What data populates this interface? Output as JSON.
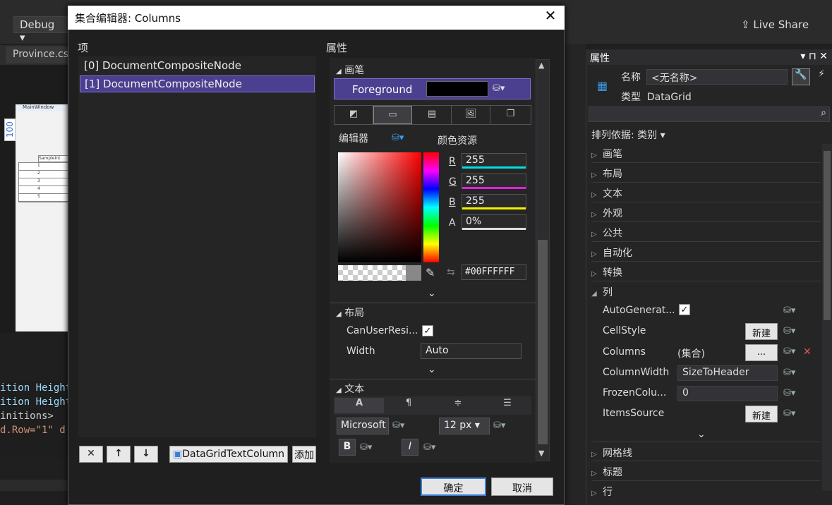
{
  "toolbar": {
    "config": "Debug",
    "live_share": "Live Share"
  },
  "editor_tab": "Province.cs",
  "designer": {
    "window_title": "MainWindow",
    "grid_header": "SampleInt",
    "rows": [
      "1",
      "2",
      "3",
      "4",
      "5"
    ],
    "ruler_value": "100"
  },
  "code_lines": [
    "ition Height=",
    "ition Height=",
    "initions>",
    "d.Row=\"1\" d:I"
  ],
  "properties_panel": {
    "title": "属性",
    "name_label": "名称",
    "name_value": "<无名称>",
    "type_label": "类型",
    "type_value": "DataGrid",
    "sort_label": "排列依据: 类别",
    "categories_top": [
      "画笔",
      "布局",
      "文本",
      "外观",
      "公共",
      "自动化",
      "转换"
    ],
    "expanded_category": "列",
    "rows": [
      {
        "name": "AutoGenerat...",
        "value": ""
      },
      {
        "name": "CellStyle",
        "value": "新建"
      },
      {
        "name": "Columns",
        "value": "(集合)",
        "button": "..."
      },
      {
        "name": "ColumnWidth",
        "value": "SizeToHeader"
      },
      {
        "name": "FrozenColu...",
        "value": "0"
      },
      {
        "name": "ItemsSource",
        "value": "新建"
      }
    ],
    "categories_bottom": [
      "网格线",
      "标题",
      "行"
    ]
  },
  "dialog": {
    "title": "集合编辑器: Columns",
    "items_label": "项",
    "props_label": "属性",
    "items": [
      "[0] DocumentCompositeNode",
      "[1] DocumentCompositeNode"
    ],
    "selected_item": 1,
    "add_combo": "DataGridTextColumn",
    "add_button": "添加",
    "brush_section": "画笔",
    "foreground_label": "Foreground",
    "foreground_color": "#000000",
    "editor_label": "编辑器",
    "resource_label": "颜色资源",
    "rgba": {
      "R": "255",
      "G": "255",
      "B": "255",
      "A": "0%"
    },
    "hex": "#00FFFFFF",
    "layout_section": "布局",
    "can_user_resize_label": "CanUserResi...",
    "width_label": "Width",
    "width_value": "Auto",
    "text_section": "文本",
    "font_family": "Microsoft",
    "font_size": "12 px",
    "bold": "B",
    "italic": "I",
    "ok": "确定",
    "cancel": "取消"
  }
}
